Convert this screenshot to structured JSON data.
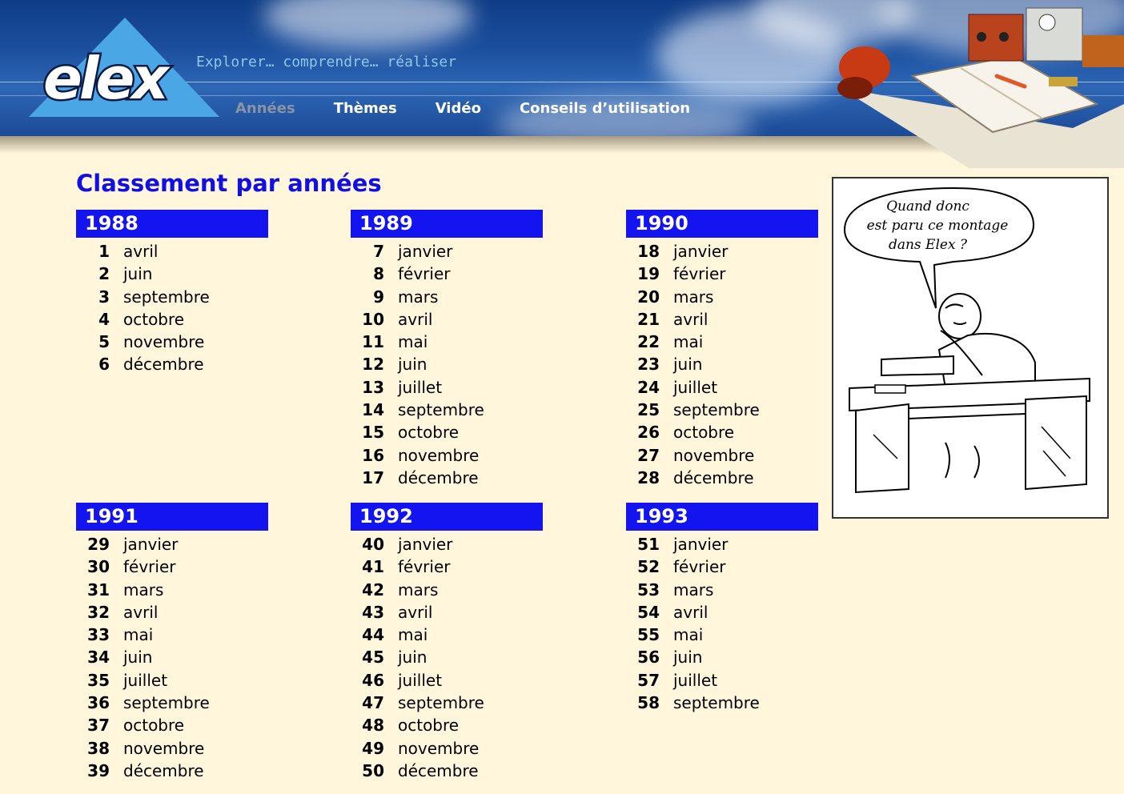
{
  "brand": {
    "logo_text": "elex",
    "tagline": "Explorer… comprendre… réaliser"
  },
  "nav": {
    "items": [
      {
        "label": "Années",
        "active": true
      },
      {
        "label": "Thèmes",
        "active": false
      },
      {
        "label": "Vidéo",
        "active": false
      },
      {
        "label": "Conseils d’utilisation",
        "active": false
      }
    ]
  },
  "colors": {
    "accent_blue": "#1414f0",
    "title_blue": "#1010e6",
    "background": "#fff6dc",
    "nav_inactive": "#8a93a6"
  },
  "main": {
    "title": "Classement par années",
    "years": [
      {
        "year": "1988",
        "issues": [
          {
            "num": "1",
            "month": "avril"
          },
          {
            "num": "2",
            "month": "juin"
          },
          {
            "num": "3",
            "month": "septembre"
          },
          {
            "num": "4",
            "month": "octobre"
          },
          {
            "num": "5",
            "month": "novembre"
          },
          {
            "num": "6",
            "month": "décembre"
          }
        ]
      },
      {
        "year": "1989",
        "issues": [
          {
            "num": "7",
            "month": "janvier"
          },
          {
            "num": "8",
            "month": "février"
          },
          {
            "num": "9",
            "month": "mars"
          },
          {
            "num": "10",
            "month": "avril"
          },
          {
            "num": "11",
            "month": "mai"
          },
          {
            "num": "12",
            "month": "juin"
          },
          {
            "num": "13",
            "month": "juillet"
          },
          {
            "num": "14",
            "month": "septembre"
          },
          {
            "num": "15",
            "month": "octobre"
          },
          {
            "num": "16",
            "month": "novembre"
          },
          {
            "num": "17",
            "month": "décembre"
          }
        ]
      },
      {
        "year": "1990",
        "issues": [
          {
            "num": "18",
            "month": "janvier"
          },
          {
            "num": "19",
            "month": "février"
          },
          {
            "num": "20",
            "month": "mars"
          },
          {
            "num": "21",
            "month": "avril"
          },
          {
            "num": "22",
            "month": "mai"
          },
          {
            "num": "23",
            "month": "juin"
          },
          {
            "num": "24",
            "month": "juillet"
          },
          {
            "num": "25",
            "month": "septembre"
          },
          {
            "num": "26",
            "month": "octobre"
          },
          {
            "num": "27",
            "month": "novembre"
          },
          {
            "num": "28",
            "month": "décembre"
          }
        ]
      },
      {
        "year": "1991",
        "issues": [
          {
            "num": "29",
            "month": "janvier"
          },
          {
            "num": "30",
            "month": "février"
          },
          {
            "num": "31",
            "month": "mars"
          },
          {
            "num": "32",
            "month": "avril"
          },
          {
            "num": "33",
            "month": "mai"
          },
          {
            "num": "34",
            "month": "juin"
          },
          {
            "num": "35",
            "month": "juillet"
          },
          {
            "num": "36",
            "month": "septembre"
          },
          {
            "num": "37",
            "month": "octobre"
          },
          {
            "num": "38",
            "month": "novembre"
          },
          {
            "num": "39",
            "month": "décembre"
          }
        ]
      },
      {
        "year": "1992",
        "issues": [
          {
            "num": "40",
            "month": "janvier"
          },
          {
            "num": "41",
            "month": "février"
          },
          {
            "num": "42",
            "month": "mars"
          },
          {
            "num": "43",
            "month": "avril"
          },
          {
            "num": "44",
            "month": "mai"
          },
          {
            "num": "45",
            "month": "juin"
          },
          {
            "num": "46",
            "month": "juillet"
          },
          {
            "num": "47",
            "month": "septembre"
          },
          {
            "num": "48",
            "month": "octobre"
          },
          {
            "num": "49",
            "month": "novembre"
          },
          {
            "num": "50",
            "month": "décembre"
          }
        ]
      },
      {
        "year": "1993",
        "issues": [
          {
            "num": "51",
            "month": "janvier"
          },
          {
            "num": "52",
            "month": "février"
          },
          {
            "num": "53",
            "month": "mars"
          },
          {
            "num": "54",
            "month": "avril"
          },
          {
            "num": "55",
            "month": "mai"
          },
          {
            "num": "56",
            "month": "juin"
          },
          {
            "num": "57",
            "month": "juillet"
          },
          {
            "num": "58",
            "month": "septembre"
          }
        ]
      }
    ]
  },
  "cartoon": {
    "speech_lines": [
      "Quand donc",
      "est paru ce montage",
      "dans Elex ?"
    ]
  }
}
